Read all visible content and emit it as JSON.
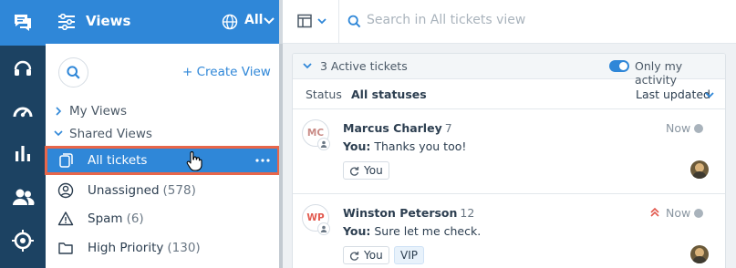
{
  "colors": {
    "rail": "#1c4262",
    "accent": "#2f87d8",
    "selection_outline": "#e8664a"
  },
  "rail": {
    "items": [
      {
        "icon": "conversations-icon",
        "active": true
      },
      {
        "icon": "headset-icon",
        "active": false
      },
      {
        "icon": "dashboard-gauge-icon",
        "active": false
      },
      {
        "icon": "reports-bar-icon",
        "active": false
      },
      {
        "icon": "contacts-icon",
        "active": false
      },
      {
        "icon": "settings-target-icon",
        "active": false
      }
    ]
  },
  "views_panel": {
    "title": "Views",
    "scope": "All",
    "create_view_label": "+ Create View",
    "groups": {
      "my_views": "My Views",
      "shared_views": "Shared Views"
    },
    "items": [
      {
        "label": "All tickets",
        "count": "",
        "icon": "tickets-icon",
        "selected": true
      },
      {
        "label": "Unassigned",
        "count": "(578)",
        "icon": "user-circle-icon",
        "selected": false
      },
      {
        "label": "Spam",
        "count": "(6)",
        "icon": "warning-icon",
        "selected": false
      },
      {
        "label": "High Priority",
        "count": "(130)",
        "icon": "folder-icon",
        "selected": false
      }
    ]
  },
  "toolbar": {
    "search_placeholder": "Search in All tickets view"
  },
  "list": {
    "active_label": "3 Active tickets",
    "only_my_activity_label": "Only my activity",
    "only_my_activity_on": true,
    "status_label": "Status",
    "status_value": "All statuses",
    "sort_label": "Last updated",
    "tickets": [
      {
        "initials": "MC",
        "name": "Marcus Charley",
        "number": "7",
        "sender": "You:",
        "message": "Thanks you too!",
        "time": "Now",
        "tags": [
          "You"
        ],
        "high_priority": false
      },
      {
        "initials": "WP",
        "name": "Winston Peterson",
        "number": "12",
        "sender": "You:",
        "message": "Sure let me check.",
        "time": "Now",
        "tags": [
          "You",
          "VIP"
        ],
        "high_priority": true
      }
    ]
  }
}
